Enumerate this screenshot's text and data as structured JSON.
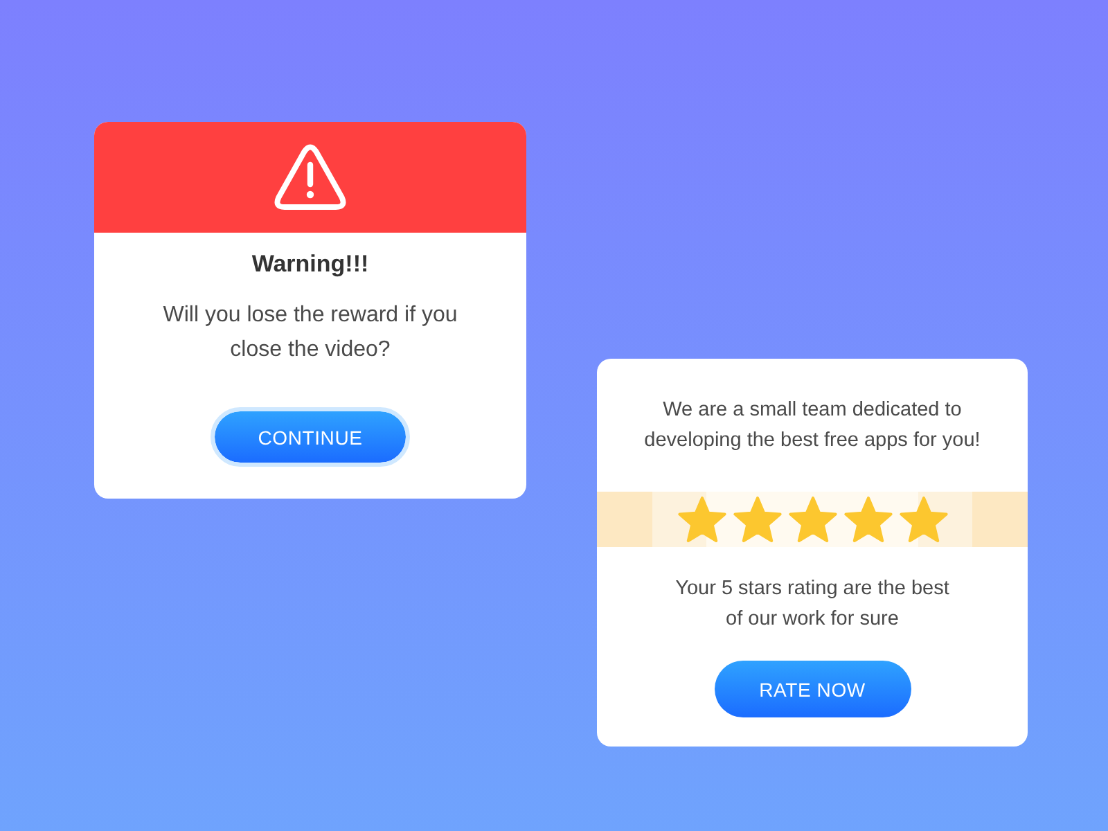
{
  "warning_dialog": {
    "title": "Warning!!!",
    "message": "Will you lose the reward if you\nclose the video?",
    "button": {
      "label": "CONTINUE",
      "focused": true
    }
  },
  "rating_dialog": {
    "intro": "We are a small team dedicated to\ndeveloping the best free apps for you!",
    "stars": 5,
    "message": "Your 5 stars rating are the best\nof our work for sure",
    "button": {
      "label": "RATE NOW",
      "focused": false
    }
  }
}
